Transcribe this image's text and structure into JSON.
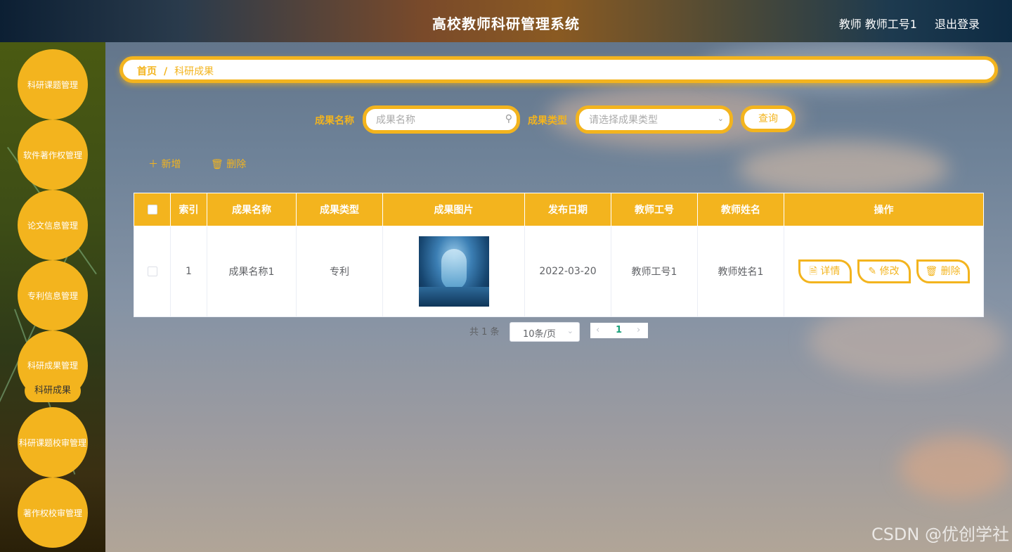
{
  "header": {
    "title": "高校教师科研管理系统",
    "user": "教师 教师工号1",
    "logout": "退出登录"
  },
  "sidebar": {
    "items": [
      {
        "label": "科研课题管理"
      },
      {
        "label": "软件著作权管理"
      },
      {
        "label": "论文信息管理"
      },
      {
        "label": "专利信息管理"
      },
      {
        "label": "科研成果管理"
      },
      {
        "label": "科研课题校审管理"
      },
      {
        "label": "著作权校审管理"
      }
    ],
    "submenu": "科研成果"
  },
  "breadcrumb": {
    "home": "首页",
    "separator": "/",
    "current": "科研成果"
  },
  "search": {
    "name_label": "成果名称",
    "name_placeholder": "成果名称",
    "type_label": "成果类型",
    "type_placeholder": "请选择成果类型",
    "query_button": "查询"
  },
  "actions": {
    "add": "新增",
    "delete": "删除"
  },
  "table": {
    "headers": [
      "索引",
      "成果名称",
      "成果类型",
      "成果图片",
      "发布日期",
      "教师工号",
      "教师姓名",
      "操作"
    ],
    "rows": [
      {
        "index": "1",
        "name": "成果名称1",
        "type": "专利",
        "date": "2022-03-20",
        "teacher_id": "教师工号1",
        "teacher_name": "教师姓名1"
      }
    ],
    "row_buttons": {
      "detail": "详情",
      "edit": "修改",
      "delete": "删除"
    }
  },
  "pagination": {
    "total": "共 1 条",
    "page_size": "10条/页",
    "current_page": "1"
  },
  "watermark": "CSDN @优创学社",
  "colors": {
    "accent": "#f3b41e"
  }
}
